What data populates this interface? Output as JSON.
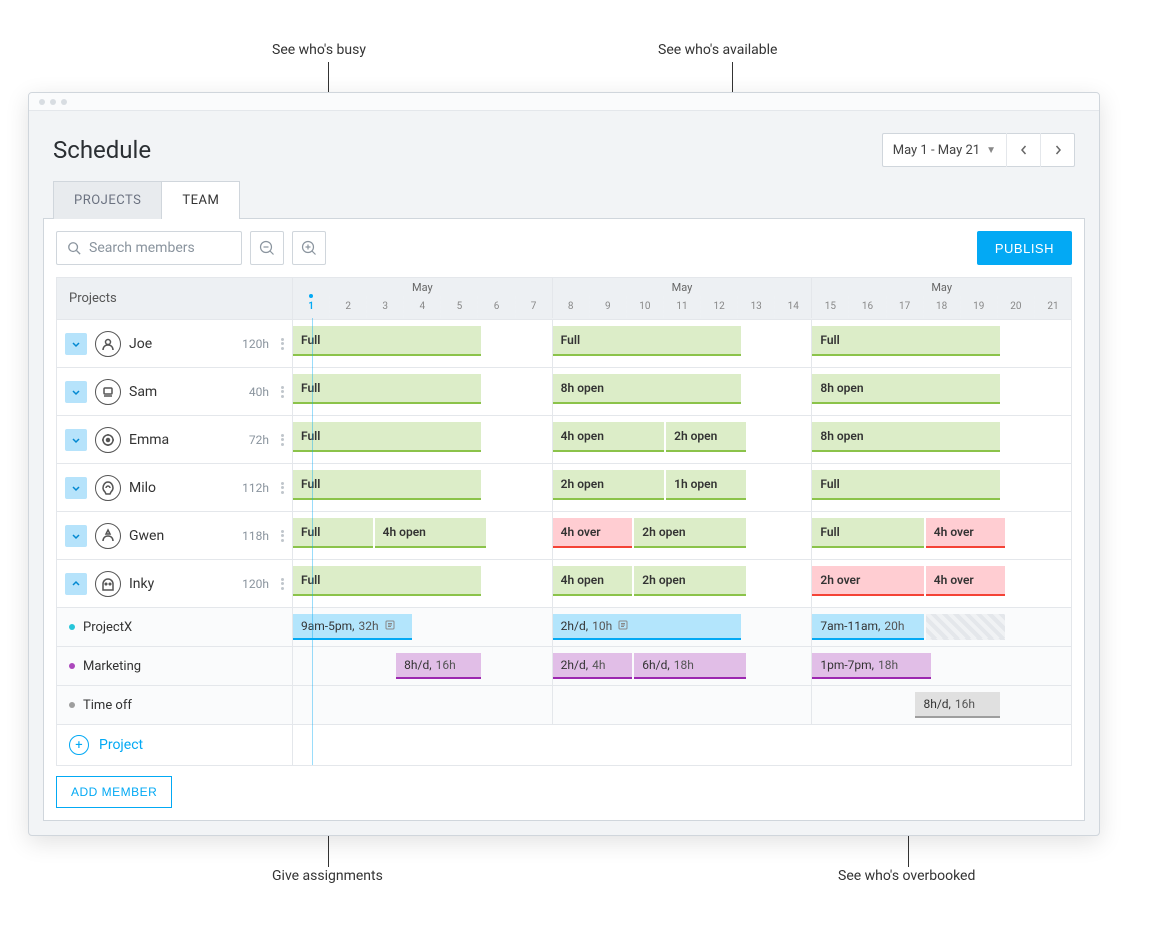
{
  "annotations": {
    "busy": "See who's busy",
    "available": "See who's available",
    "assignments": "Give assignments",
    "overbooked": "See who's overbooked"
  },
  "header": {
    "title": "Schedule",
    "date_range": "May 1 - May 21",
    "publish": "PUBLISH"
  },
  "tabs": {
    "projects": "PROJECTS",
    "team": "TEAM"
  },
  "search": {
    "placeholder": "Search members"
  },
  "grid": {
    "left_header": "Projects",
    "month": "May",
    "weeks": [
      {
        "days": [
          "1",
          "2",
          "3",
          "4",
          "5",
          "6",
          "7"
        ]
      },
      {
        "days": [
          "8",
          "9",
          "10",
          "11",
          "12",
          "13",
          "14"
        ]
      },
      {
        "days": [
          "15",
          "16",
          "17",
          "18",
          "19",
          "20",
          "21"
        ]
      }
    ],
    "today_day": "1"
  },
  "members": [
    {
      "name": "Joe",
      "hours": "120h",
      "expanded": false,
      "weeks": [
        [
          {
            "label": "Full",
            "cls": "green",
            "span": 5
          }
        ],
        [
          {
            "label": "Full",
            "cls": "green",
            "span": 5
          }
        ],
        [
          {
            "label": "Full",
            "cls": "green",
            "span": 5
          }
        ]
      ]
    },
    {
      "name": "Sam",
      "hours": "40h",
      "expanded": false,
      "weeks": [
        [
          {
            "label": "Full",
            "cls": "green",
            "span": 5
          }
        ],
        [
          {
            "label": "8h open",
            "cls": "green",
            "span": 5
          }
        ],
        [
          {
            "label": "8h open",
            "cls": "green",
            "span": 5
          }
        ]
      ]
    },
    {
      "name": "Emma",
      "hours": "72h",
      "expanded": false,
      "weeks": [
        [
          {
            "label": "Full",
            "cls": "green",
            "span": 5
          }
        ],
        [
          {
            "label": "4h open",
            "cls": "green",
            "span": 3
          },
          {
            "label": "2h open",
            "cls": "green",
            "span": 2
          }
        ],
        [
          {
            "label": "8h open",
            "cls": "green",
            "span": 5
          }
        ]
      ]
    },
    {
      "name": "Milo",
      "hours": "112h",
      "expanded": false,
      "weeks": [
        [
          {
            "label": "Full",
            "cls": "green",
            "span": 5
          }
        ],
        [
          {
            "label": "2h open",
            "cls": "green",
            "span": 3
          },
          {
            "label": "1h open",
            "cls": "green",
            "span": 2
          }
        ],
        [
          {
            "label": "Full",
            "cls": "green",
            "span": 5
          }
        ]
      ]
    },
    {
      "name": "Gwen",
      "hours": "118h",
      "expanded": false,
      "weeks": [
        [
          {
            "label": "Full",
            "cls": "green",
            "span": 2
          },
          {
            "label": "4h open",
            "cls": "green",
            "span": 3
          }
        ],
        [
          {
            "label": "4h over",
            "cls": "red",
            "span": 2
          },
          {
            "label": "2h open",
            "cls": "green",
            "span": 3
          }
        ],
        [
          {
            "label": "Full",
            "cls": "green",
            "span": 3
          },
          {
            "label": "4h over",
            "cls": "red",
            "span": 2
          }
        ]
      ]
    },
    {
      "name": "Inky",
      "hours": "120h",
      "expanded": true,
      "weeks": [
        [
          {
            "label": "Full",
            "cls": "green",
            "span": 5
          }
        ],
        [
          {
            "label": "4h open",
            "cls": "green",
            "span": 2
          },
          {
            "label": "2h open",
            "cls": "green",
            "span": 3
          }
        ],
        [
          {
            "label": "2h over",
            "cls": "red",
            "span": 3
          },
          {
            "label": "4h over",
            "cls": "red",
            "span": 2
          }
        ]
      ]
    }
  ],
  "subrows": {
    "projectx": {
      "label": "ProjectX",
      "weeks": [
        [
          {
            "label": "9am-5pm,",
            "sub": "32h",
            "cls": "blue",
            "span": 3,
            "note": true
          }
        ],
        [
          {
            "label": "2h/d,",
            "sub": "10h",
            "cls": "blue",
            "span": 5,
            "note": true
          }
        ],
        [
          {
            "label": "7am-11am,",
            "sub": "20h",
            "cls": "blue",
            "span": 3
          },
          {
            "label": "",
            "cls": "hatched",
            "span": 2
          }
        ]
      ]
    },
    "marketing": {
      "label": "Marketing",
      "weeks": [
        [
          {
            "label": "",
            "cls": "none",
            "span": 3,
            "empty": true
          },
          {
            "label": "8h/d,",
            "sub": "16h",
            "cls": "purple",
            "span": 2
          }
        ],
        [
          {
            "label": "2h/d,",
            "sub": "4h",
            "cls": "purple",
            "span": 2
          },
          {
            "label": "6h/d,",
            "sub": "18h",
            "cls": "purple",
            "span": 3
          }
        ],
        [
          {
            "label": "1pm-7pm,",
            "sub": "18h",
            "cls": "purple",
            "span": 3
          }
        ]
      ]
    },
    "timeoff": {
      "label": "Time off",
      "weeks": [
        [],
        [],
        [
          {
            "label": "",
            "cls": "none",
            "span": 3,
            "empty": true
          },
          {
            "label": "8h/d,",
            "sub": "16h",
            "cls": "grey",
            "span": 2
          }
        ]
      ]
    }
  },
  "add_project": "Project",
  "add_member": "ADD MEMBER"
}
